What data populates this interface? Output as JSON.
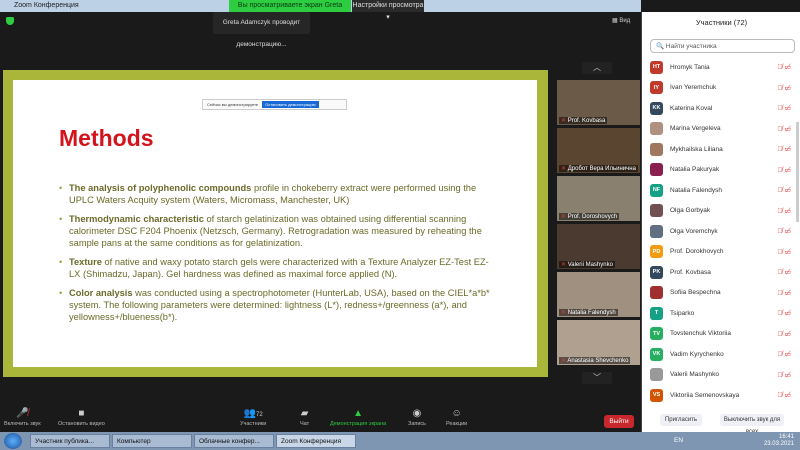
{
  "window": {
    "title": "Zoom Конференция",
    "banner": "Вы просматриваете экран Greta Adamczyk",
    "view_settings": "Настройки просмотра ▾",
    "tooltip": "Greta Adamczyk проводит демонстрацию...",
    "view": "Вид"
  },
  "share_bar": {
    "text": "Сейчас вы демонстрируете",
    "button": "Остановить демонстрацию"
  },
  "slide": {
    "title": "Methods",
    "bullets": [
      {
        "bold": "The analysis of polyphenolic compounds",
        "text": " profile in chokeberry extract were performed using the UPLC Waters Acquity system (Waters, Micromass, Manchester, UK)"
      },
      {
        "bold": "Thermodynamic characteristic",
        "text": " of starch gelatinization was obtained using differential scanning calorimeter DSC F204 Phoenix (Netzsch, Germany). Retrogradation was measured by reheating the sample pans at the same conditions as for gelatinization."
      },
      {
        "bold": "Texture",
        "text": " of native and waxy potato starch gels were characterized with a Texture Analyzer EZ-Test EZ-LX (Shimadzu, Japan). Gel hardness was defined as maximal force applied (N)."
      },
      {
        "bold": "Color analysis",
        "text": " was conducted using a spectrophotometer (HunterLab, USA), based on the CIEL*a*b* system. The following parameters were determined: lightness (L*), redness+/greenness (a*), and yellowness+/blueness(b*)."
      }
    ]
  },
  "videos": [
    "Prof. Kovbasa",
    "Дробот Вера Ильинична",
    "Prof. Doroshovych",
    "Valerii Mashynko",
    "Natalia Falendysh",
    "Anastasia Shevchenko"
  ],
  "participants": {
    "title": "Участники (72)",
    "search_placeholder": "Найти участника",
    "items": [
      {
        "initials": "HT",
        "name": "Hromyk Tania",
        "color": "#c0392b"
      },
      {
        "initials": "IY",
        "name": "Ivan Yeremchuk",
        "color": "#c0392b"
      },
      {
        "initials": "KK",
        "name": "Katerina Koval",
        "color": "#34495e"
      },
      {
        "initials": "",
        "name": "Marina Vergeleva",
        "color": "#b09080"
      },
      {
        "initials": "",
        "name": "Mykhailska Liliana",
        "color": "#a07860"
      },
      {
        "initials": "",
        "name": "Natalia Pakuryak",
        "color": "#8a2050"
      },
      {
        "initials": "NF",
        "name": "Natalia Falendysh",
        "color": "#16a085"
      },
      {
        "initials": "",
        "name": "Olga Gorbyak",
        "color": "#705050"
      },
      {
        "initials": "",
        "name": "Olga Voremchyk",
        "color": "#607080"
      },
      {
        "initials": "PD",
        "name": "Prof. Dorokhovych",
        "color": "#f39c12"
      },
      {
        "initials": "PK",
        "name": "Prof. Kovbasa",
        "color": "#34495e"
      },
      {
        "initials": "",
        "name": "Sofiia Bespechna",
        "color": "#a03030"
      },
      {
        "initials": "T",
        "name": "Tsiparko",
        "color": "#16a085"
      },
      {
        "initials": "TV",
        "name": "Tovstenchuk Viktoriia",
        "color": "#27ae60"
      },
      {
        "initials": "VK",
        "name": "Vadim Kyrychenko",
        "color": "#27ae60"
      },
      {
        "initials": "",
        "name": "Valerii Mashynko",
        "color": "#999999"
      },
      {
        "initials": "VS",
        "name": "Viktoriia Semenovskaya",
        "color": "#d35400"
      }
    ],
    "invite": "Пригласить",
    "mute_all": "Выключить звук для всех"
  },
  "toolbar": {
    "mute": "Включить звук",
    "video": "Остановить видео",
    "participants": "Участники",
    "count": "72",
    "chat": "Чат",
    "share": "Демонстрация экрана",
    "record": "Запись",
    "reactions": "Реакции",
    "leave": "Выйти"
  },
  "taskbar": {
    "tasks": [
      "Участник публика...",
      "Компьютер",
      "Облачные конфер...",
      "Zoom Конференция"
    ],
    "lang": "EN",
    "time": "16:41",
    "date": "23.03.2021"
  }
}
